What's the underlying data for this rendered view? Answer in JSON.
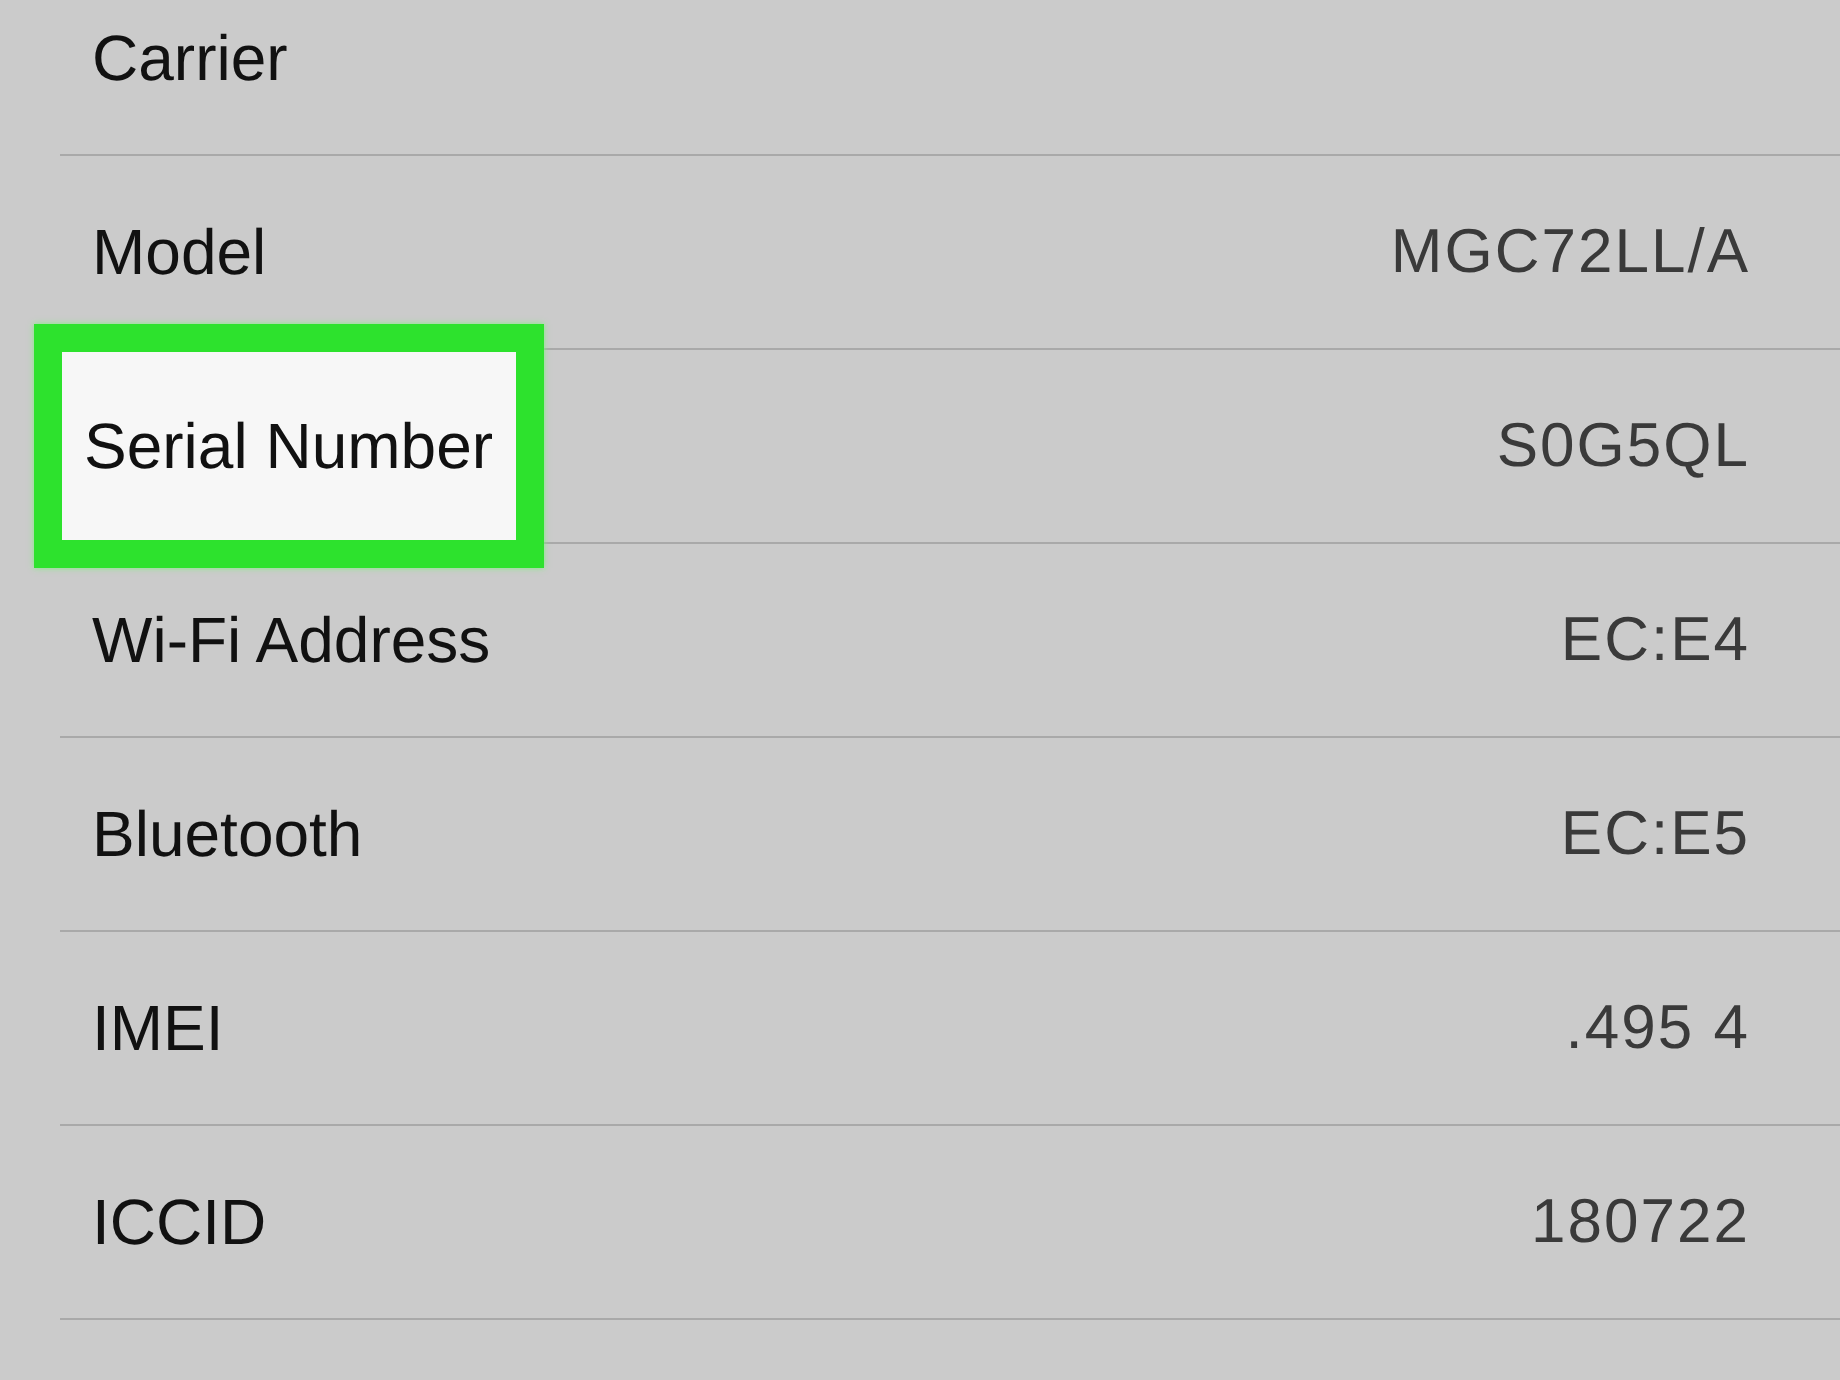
{
  "rows": [
    {
      "label": "Carrier",
      "highlighted": false
    },
    {
      "label": "Model",
      "value": "MGC72LL/A",
      "highlighted": false
    },
    {
      "label": "Serial Number",
      "value": "S0G5QL",
      "highlighted": true
    },
    {
      "label": "Wi-Fi Address",
      "value": "EC:E4",
      "highlighted": false
    },
    {
      "label": "Bluetooth",
      "value": "EC:E5",
      "highlighted": false
    },
    {
      "label": "IMEI",
      "value": ".495 4",
      "highlighted": false
    },
    {
      "label": "ICCID",
      "value": "180722",
      "highlighted": false
    }
  ]
}
